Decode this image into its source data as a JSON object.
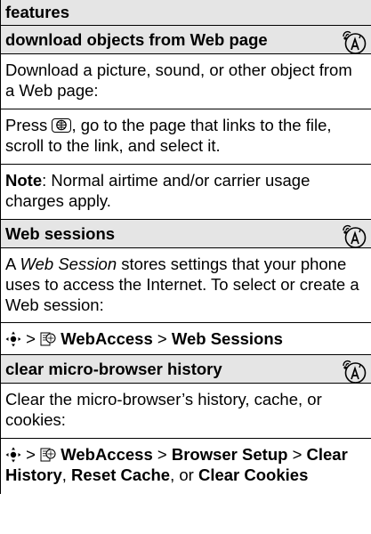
{
  "table": {
    "header": "features",
    "sections": [
      {
        "title": "download objects from Web page",
        "paragraphs": [
          "Download a picture, sound, or other object from a Web page:",
          [
            "Press ",
            ", go to the page that links to the file, scroll to the link, and select it."
          ],
          [
            "Note",
            ": Normal airtime and/or carrier usage charges apply."
          ]
        ]
      },
      {
        "title": "Web sessions",
        "paragraphs": [
          [
            "A ",
            "Web Session",
            " stores settings that your phone uses to access the Internet. To select or create a Web session:"
          ],
          [
            "WebAccess",
            "Web Sessions"
          ]
        ]
      },
      {
        "title": "clear micro-browser history",
        "paragraphs": [
          "Clear the micro-browser’s history, cache, or cookies:",
          [
            "WebAccess",
            "Browser Setup",
            "Clear History",
            "Reset Cache",
            "Clear Cookies",
            ", ",
            ", or "
          ]
        ]
      }
    ]
  },
  "icons": {
    "operator": "network-operator-feature-icon",
    "browser_key": "browser-key-icon",
    "nav": "navigation-key-icon",
    "web": "web-access-icon"
  },
  "separator": ">"
}
